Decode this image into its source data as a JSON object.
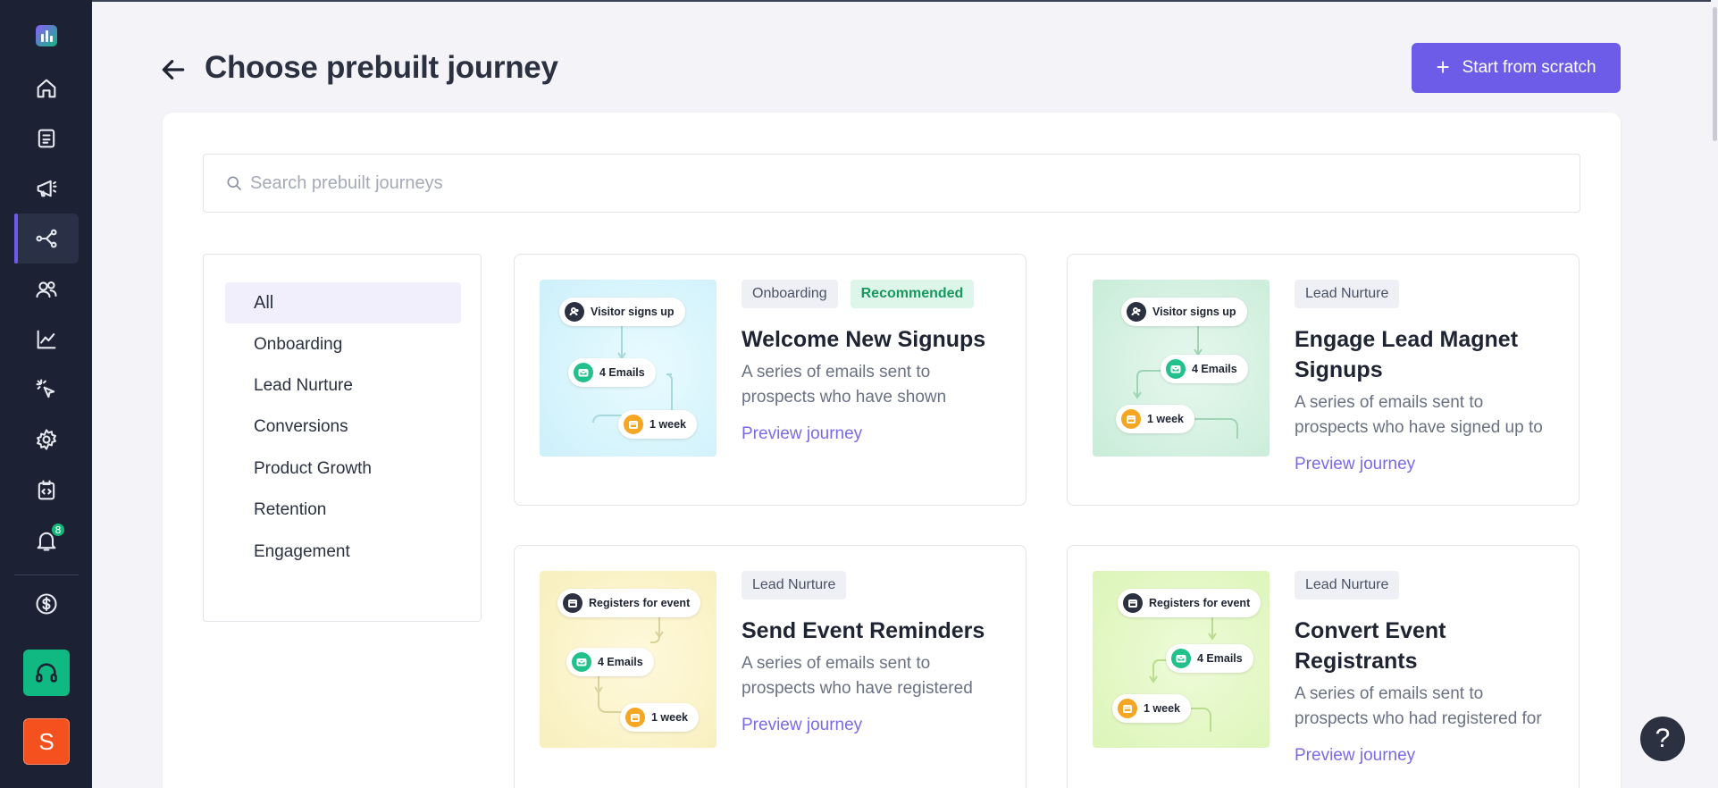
{
  "header": {
    "title": "Choose prebuilt journey",
    "start_button": "Start from scratch"
  },
  "search": {
    "placeholder": "Search prebuilt journeys"
  },
  "sidebar": {
    "notification_count": "8",
    "avatar_initial": "S",
    "items": [
      "logo",
      "home-icon",
      "forms-icon",
      "campaigns-icon",
      "journeys-icon",
      "contacts-icon",
      "reports-icon",
      "actions-icon",
      "settings-icon",
      "integrations-icon",
      "notifications-icon",
      "billing-icon"
    ]
  },
  "filters": [
    "All",
    "Onboarding",
    "Lead Nurture",
    "Conversions",
    "Product Growth",
    "Retention",
    "Engagement"
  ],
  "journeys": [
    {
      "tags": [
        "Onboarding",
        "Recommended"
      ],
      "title": "Welcome New Signups",
      "description": "A series of emails sent to prospects who have shown",
      "link": "Preview journey",
      "nodes": [
        "Visitor signs up",
        "4 Emails",
        "1 week"
      ]
    },
    {
      "tags": [
        "Lead Nurture"
      ],
      "title": "Engage Lead Magnet Signups",
      "description": "A series of emails sent to prospects who have signed up to",
      "link": "Preview journey",
      "nodes": [
        "Visitor signs up",
        "4 Emails",
        "1 week"
      ]
    },
    {
      "tags": [
        "Lead Nurture"
      ],
      "title": "Send Event Reminders",
      "description": "A series of emails sent to prospects who have registered",
      "link": "Preview journey",
      "nodes": [
        "Registers for event",
        "4 Emails",
        "1 week"
      ]
    },
    {
      "tags": [
        "Lead Nurture"
      ],
      "title": "Convert Event Registrants",
      "description": "A series of emails sent to prospects who had registered for",
      "link": "Preview journey",
      "nodes": [
        "Registers for event",
        "4 Emails",
        "1 week"
      ]
    }
  ],
  "help_label": "?",
  "colors": {
    "sidebar": "#1c2234",
    "accent": "#6c5ce7",
    "recommended": "#17985f",
    "thumb_blue": "#d6f4fb",
    "thumb_green": "#d9f3e3",
    "thumb_yellow": "#fbf3cc",
    "thumb_lime": "#e6f7c9"
  }
}
